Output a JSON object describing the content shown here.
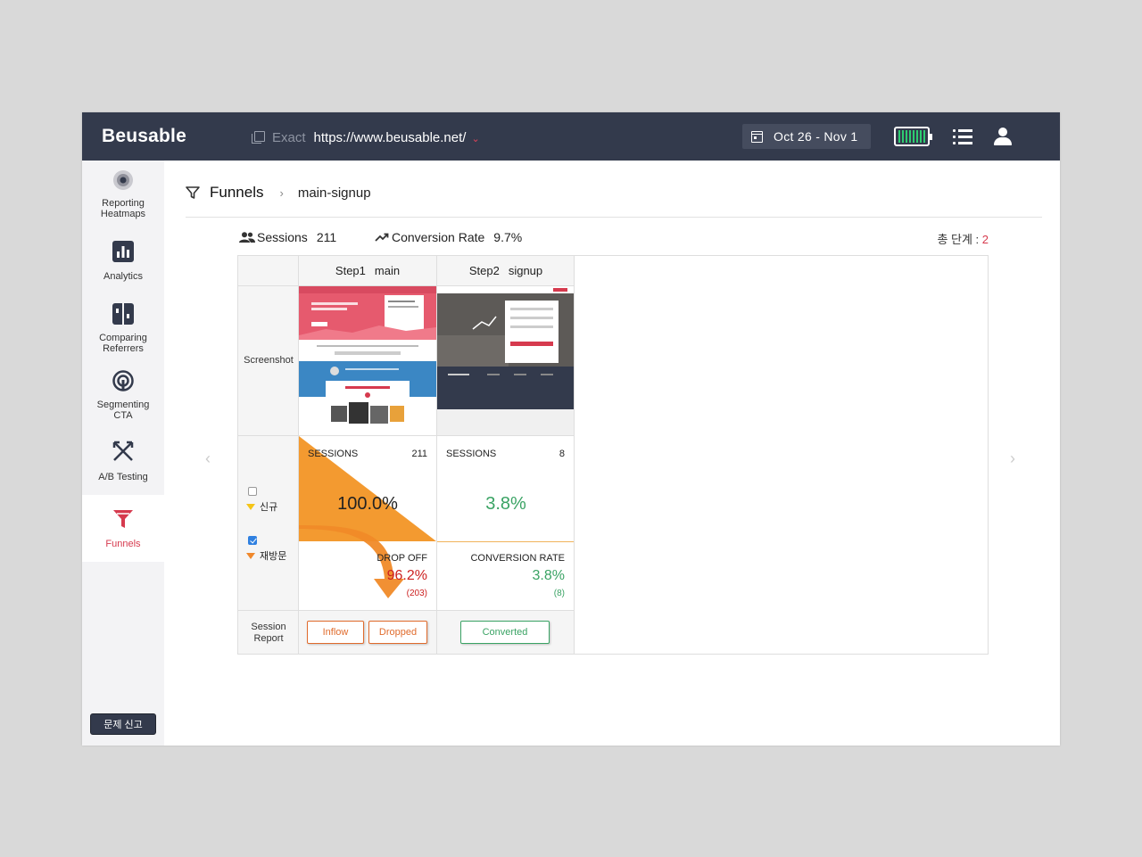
{
  "header": {
    "logo": "Beusable",
    "match_mode": "Exact",
    "url": "https://www.beusable.net/",
    "date_range": "Oct 26 - Nov 1",
    "accent_color": "#e0435a",
    "battery_color": "#2ecc71"
  },
  "sidebar": {
    "items": [
      {
        "label": "Reporting\nHeatmaps",
        "icon": "heatmap-icon"
      },
      {
        "label": "Analytics",
        "icon": "bar-chart-icon"
      },
      {
        "label": "Comparing\nReferrers",
        "icon": "compare-icon"
      },
      {
        "label": "Segmenting\nCTA",
        "icon": "target-icon"
      },
      {
        "label": "A/B Testing",
        "icon": "ab-test-icon"
      },
      {
        "label": "Funnels",
        "icon": "funnel-icon"
      }
    ],
    "active": "Funnels",
    "report_button": "문제 신고"
  },
  "page": {
    "title": "Funnels",
    "breadcrumb": "main-signup"
  },
  "stats": {
    "sessions_label": "Sessions",
    "sessions_value": "211",
    "conversion_label": "Conversion Rate",
    "conversion_value": "9.7%",
    "total_steps_label": "총 단계 : ",
    "total_steps_value": "2"
  },
  "funnel": {
    "row_labels": {
      "screenshot": "Screenshot",
      "session_report": "Session\nReport"
    },
    "segments": [
      {
        "label": "신규",
        "checked": false,
        "color": "#f5c518"
      },
      {
        "label": "재방문",
        "checked": true,
        "color": "#f0882c"
      }
    ],
    "steps": [
      {
        "step": "Step1",
        "name": "main",
        "sessions_label": "SESSIONS",
        "sessions": "211",
        "pct": "100.0%",
        "metric_label": "DROP OFF",
        "metric_pct": "96.2%",
        "metric_count": "(203)",
        "buttons": [
          "Inflow",
          "Dropped"
        ]
      },
      {
        "step": "Step2",
        "name": "signup",
        "sessions_label": "SESSIONS",
        "sessions": "8",
        "pct": "3.8%",
        "metric_label": "CONVERSION RATE",
        "metric_pct": "3.8%",
        "metric_count": "(8)",
        "buttons": [
          "Converted"
        ]
      }
    ],
    "colors": {
      "drop": "#f0882c",
      "drop_text": "#cc1f1f",
      "convert": "#3aa364"
    }
  }
}
